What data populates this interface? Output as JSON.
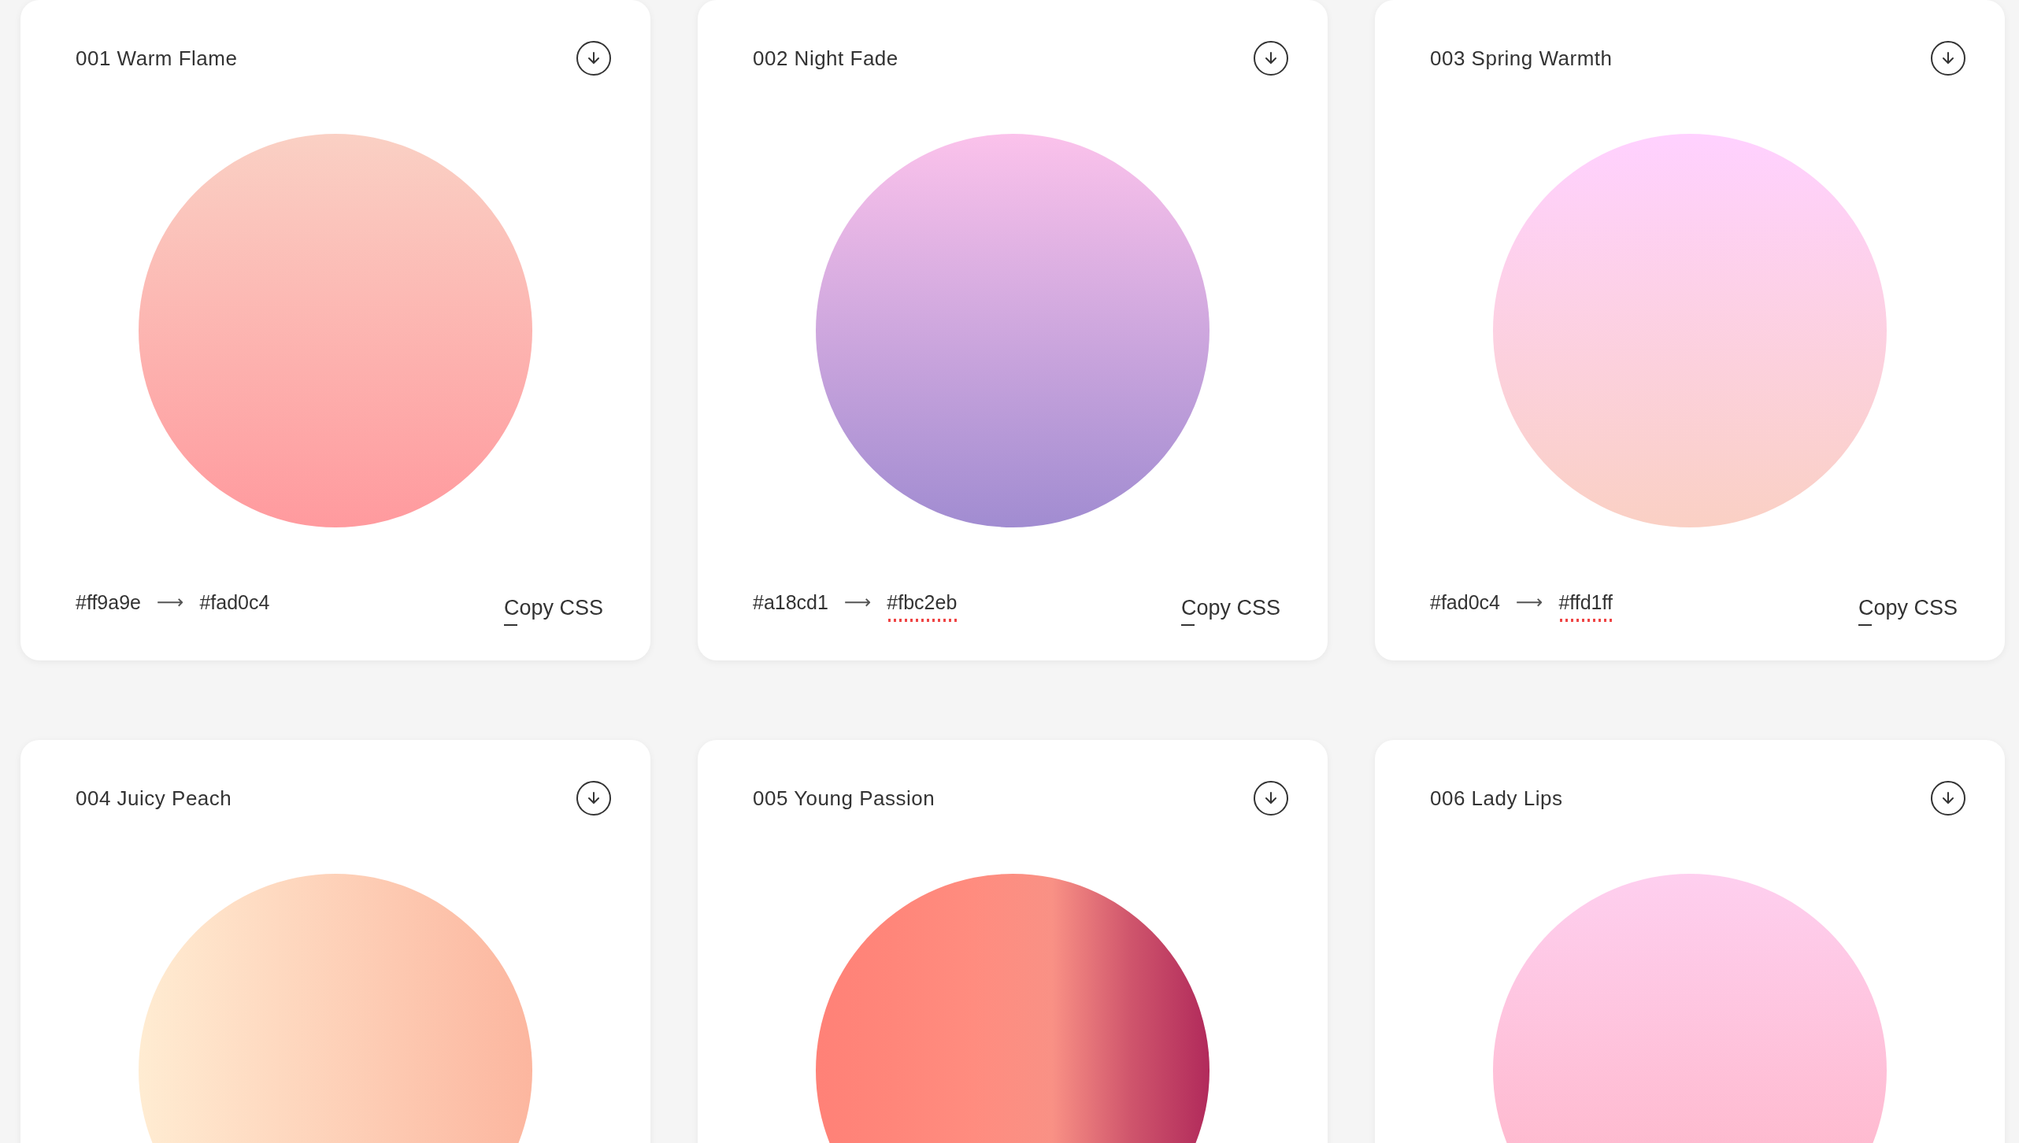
{
  "cards": [
    {
      "title": "001 Warm Flame",
      "horizontal": false,
      "stops": [
        {
          "color": "#ff9a9e"
        },
        {
          "color": "#fad0c4"
        }
      ],
      "from": {
        "text": "#ff9a9e",
        "misspelled": false
      },
      "arrow": "⟶",
      "to": {
        "text": "#fad0c4",
        "misspelled": false
      },
      "copy": "Copy CSS"
    },
    {
      "title": "002 Night Fade",
      "horizontal": false,
      "stops": [
        {
          "color": "#a18cd1"
        },
        {
          "color": "#fbc2eb"
        }
      ],
      "from": {
        "text": "#a18cd1",
        "misspelled": false
      },
      "arrow": "⟶",
      "to": {
        "text": "#fbc2eb",
        "misspelled": true
      },
      "copy": "Copy CSS"
    },
    {
      "title": "003 Spring Warmth",
      "horizontal": false,
      "stops": [
        {
          "color": "#fad0c4"
        },
        {
          "color": "#ffd1ff"
        }
      ],
      "from": {
        "text": "#fad0c4",
        "misspelled": false
      },
      "arrow": "⟶",
      "to": {
        "text": "#ffd1ff",
        "misspelled": true
      },
      "copy": "Copy CSS"
    },
    {
      "title": "004 Juicy Peach",
      "horizontal": true,
      "stops": [
        {
          "color": "#ffecd2"
        },
        {
          "color": "#fcb69f"
        }
      ]
    },
    {
      "title": "005 Young Passion",
      "horizontal": true,
      "stops": [
        {
          "color": "#ff8177"
        },
        {
          "color": "#ff867a"
        },
        {
          "color": "#ff8c7f"
        },
        {
          "color": "#f99185"
        },
        {
          "color": "#cf556c"
        },
        {
          "color": "#b12a5b"
        }
      ]
    },
    {
      "title": "006 Lady Lips",
      "horizontal": false,
      "stops": [
        {
          "color": "#ffb2c2"
        },
        {
          "color": "#fecfef"
        }
      ]
    }
  ]
}
